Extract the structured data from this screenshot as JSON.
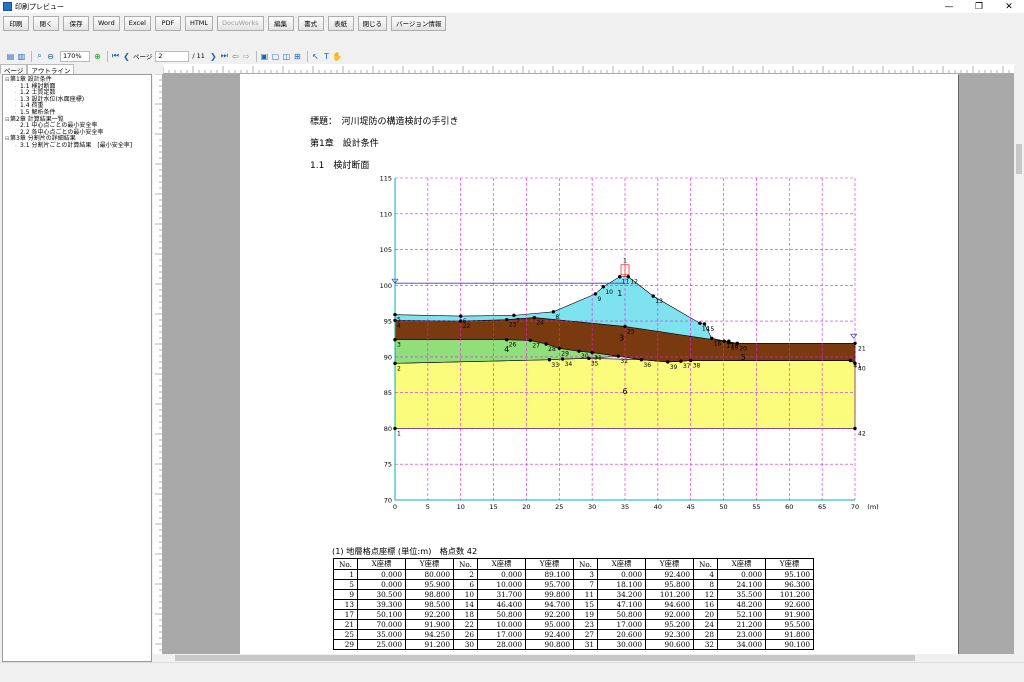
{
  "window": {
    "title": "印刷プレビュー",
    "controls": [
      "—",
      "❐",
      "✕"
    ]
  },
  "main_toolbar": [
    "印刷",
    "閉く",
    "保存",
    "Word",
    "Excel",
    "PDF",
    "HTML",
    "DocuWorks",
    "編集",
    "書式",
    "表紙",
    "閉じる",
    "バージョン情報"
  ],
  "main_toolbar_disabled": [
    "DocuWorks"
  ],
  "nav": {
    "zoom": "170%",
    "page_label": "ページ",
    "page": "2",
    "total": "/ 11"
  },
  "tabs": [
    "ページ",
    "アウトライン"
  ],
  "outline": [
    {
      "text": "第1章 設計条件",
      "level": 0,
      "toggle": "⊟"
    },
    {
      "text": "1.1 検討断面",
      "level": 1
    },
    {
      "text": "1.2 土質定数",
      "level": 1
    },
    {
      "text": "1.3 設計水位(水面座標)",
      "level": 1
    },
    {
      "text": "1.4 荷重",
      "level": 1
    },
    {
      "text": "1.5 解析条件",
      "level": 1
    },
    {
      "text": "第2章 計算結果一覧",
      "level": 0,
      "toggle": "⊟"
    },
    {
      "text": "2.1 中心点ごとの最小安全率",
      "level": 1
    },
    {
      "text": "2.2 各中心点ごとの最小安全率",
      "level": 1
    },
    {
      "text": "第3章 分割片の詳細結果",
      "level": 0,
      "toggle": "⊟"
    },
    {
      "text": "3.1 分割片ごとの計算結果　[最小安全率]",
      "level": 1
    }
  ],
  "document": {
    "heading": "標題：　河川堤防の構造検討の手引き",
    "chapter": "第1章　設計条件",
    "section": "1.1　検討断面",
    "table_caption": "(1) 地層格点座標 (単位:m)　格点数 42",
    "table_headers": [
      "No.",
      "X座標",
      "Y座標",
      "No.",
      "X座標",
      "Y座標",
      "No.",
      "X座標",
      "Y座標",
      "No.",
      "X座標",
      "Y座標"
    ],
    "table_rows": [
      [
        "1",
        "0.000",
        "80.000",
        "2",
        "0.000",
        "89.100",
        "3",
        "0.000",
        "92.400",
        "4",
        "0.000",
        "95.100"
      ],
      [
        "5",
        "0.000",
        "95.900",
        "6",
        "10.000",
        "95.700",
        "7",
        "18.100",
        "95.800",
        "8",
        "24.100",
        "96.300"
      ],
      [
        "9",
        "30.500",
        "98.800",
        "10",
        "31.700",
        "99.800",
        "11",
        "34.200",
        "101.200",
        "12",
        "35.500",
        "101.200"
      ],
      [
        "13",
        "39.300",
        "98.500",
        "14",
        "46.400",
        "94.700",
        "15",
        "47.100",
        "94.600",
        "16",
        "48.200",
        "92.600"
      ],
      [
        "17",
        "50.100",
        "92.200",
        "18",
        "50.800",
        "92.200",
        "19",
        "50.800",
        "92.000",
        "20",
        "52.100",
        "91.900"
      ],
      [
        "21",
        "70.000",
        "91.900",
        "22",
        "10.000",
        "95.000",
        "23",
        "17.000",
        "95.200",
        "24",
        "21.200",
        "95.500"
      ],
      [
        "25",
        "35.000",
        "94.250",
        "26",
        "17.000",
        "92.400",
        "27",
        "20.600",
        "92.300",
        "28",
        "23.000",
        "91.800"
      ],
      [
        "29",
        "25.000",
        "91.200",
        "30",
        "28.000",
        "90.800",
        "31",
        "30.000",
        "90.600",
        "32",
        "34.000",
        "90.100"
      ]
    ]
  },
  "chart_data": {
    "type": "cross-section",
    "xlabel": "(m)",
    "xlim": [
      0,
      70
    ],
    "ylim": [
      70,
      115
    ],
    "x_ticks": [
      0,
      5,
      10,
      15,
      20,
      25,
      30,
      35,
      40,
      45,
      50,
      55,
      60,
      65,
      70
    ],
    "y_ticks": [
      70,
      75,
      80,
      85,
      90,
      95,
      100,
      105,
      110,
      115
    ],
    "grid": true,
    "colors": {
      "layer1": "#7fe3ef",
      "layer3": "#7a3a10",
      "layer4": "#8fe07a",
      "layer6": "#fbfb7c",
      "grid": "#e020e0",
      "load": "#ff3030",
      "water": "#3a3ad0"
    },
    "water_level": 100.3,
    "load": {
      "x": 35,
      "label": "1"
    },
    "layer_labels": [
      {
        "text": "1",
        "x": 34.2,
        "y": 98.5
      },
      {
        "text": "3",
        "x": 34.5,
        "y": 92.3
      },
      {
        "text": "4",
        "x": 17,
        "y": 90.7
      },
      {
        "text": "5",
        "x": 53,
        "y": 89.6
      },
      {
        "text": "6",
        "x": 35,
        "y": 84.8
      }
    ],
    "points": [
      {
        "id": 1,
        "x": 0,
        "y": 80
      },
      {
        "id": 2,
        "x": 0,
        "y": 89.1
      },
      {
        "id": 3,
        "x": 0,
        "y": 92.4
      },
      {
        "id": 4,
        "x": 0,
        "y": 95.1
      },
      {
        "id": 5,
        "x": 0,
        "y": 95.9
      },
      {
        "id": 6,
        "x": 10,
        "y": 95.7
      },
      {
        "id": 7,
        "x": 18.1,
        "y": 95.8
      },
      {
        "id": 8,
        "x": 24.1,
        "y": 96.3
      },
      {
        "id": 9,
        "x": 30.5,
        "y": 98.8
      },
      {
        "id": 10,
        "x": 31.7,
        "y": 99.8
      },
      {
        "id": 11,
        "x": 34.2,
        "y": 101.2
      },
      {
        "id": 12,
        "x": 35.5,
        "y": 101.2
      },
      {
        "id": 13,
        "x": 39.3,
        "y": 98.5
      },
      {
        "id": 14,
        "x": 46.4,
        "y": 94.7
      },
      {
        "id": 15,
        "x": 47.1,
        "y": 94.6
      },
      {
        "id": 16,
        "x": 48.2,
        "y": 92.6
      },
      {
        "id": 17,
        "x": 50.1,
        "y": 92.2
      },
      {
        "id": 18,
        "x": 50.8,
        "y": 92.2
      },
      {
        "id": 19,
        "x": 50.8,
        "y": 92.0
      },
      {
        "id": 20,
        "x": 52.1,
        "y": 91.9
      },
      {
        "id": 21,
        "x": 70,
        "y": 91.9
      },
      {
        "id": 22,
        "x": 10,
        "y": 95.0
      },
      {
        "id": 23,
        "x": 17,
        "y": 95.2
      },
      {
        "id": 24,
        "x": 21.2,
        "y": 95.5
      },
      {
        "id": 25,
        "x": 35,
        "y": 94.25
      },
      {
        "id": 26,
        "x": 17,
        "y": 92.4
      },
      {
        "id": 27,
        "x": 20.6,
        "y": 92.3
      },
      {
        "id": 28,
        "x": 23,
        "y": 91.8
      },
      {
        "id": 29,
        "x": 25,
        "y": 91.2
      },
      {
        "id": 30,
        "x": 28,
        "y": 90.8
      },
      {
        "id": 31,
        "x": 30,
        "y": 90.6
      },
      {
        "id": 32,
        "x": 34,
        "y": 90.1
      },
      {
        "id": 33,
        "x": 23.5,
        "y": 89.6
      },
      {
        "id": 34,
        "x": 25.5,
        "y": 89.7
      },
      {
        "id": 35,
        "x": 29.5,
        "y": 89.8
      },
      {
        "id": 36,
        "x": 37.5,
        "y": 89.6
      },
      {
        "id": 37,
        "x": 43.5,
        "y": 89.4
      },
      {
        "id": 38,
        "x": 45.0,
        "y": 89.5
      },
      {
        "id": 39,
        "x": 41.5,
        "y": 89.3
      },
      {
        "id": 40,
        "x": 70,
        "y": 89.1
      },
      {
        "id": 41,
        "x": 69.3,
        "y": 89.5
      },
      {
        "id": 42,
        "x": 70,
        "y": 80
      }
    ]
  }
}
